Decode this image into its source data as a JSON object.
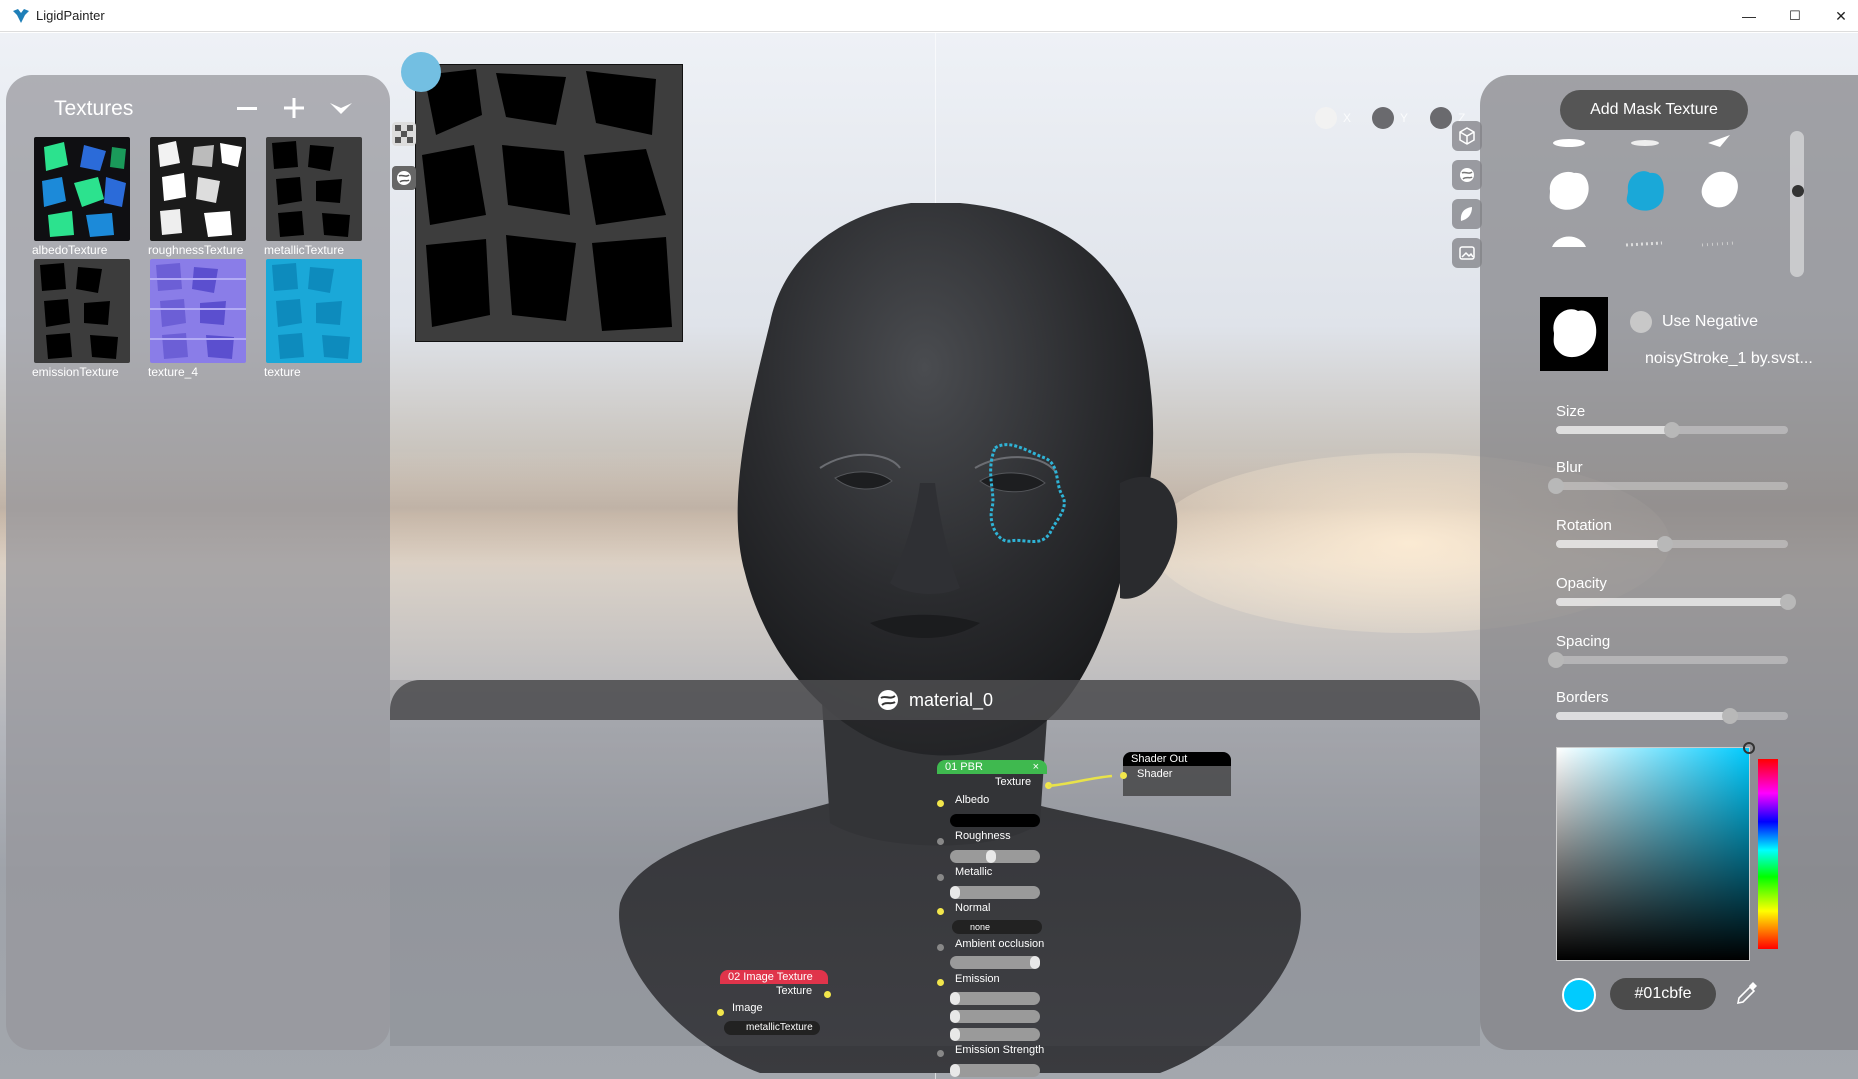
{
  "window": {
    "title": "LigidPainter",
    "controls": {
      "minimize": "—",
      "maximize": "☐",
      "close": "✕"
    }
  },
  "textures_panel": {
    "title": "Textures",
    "items": [
      {
        "label": "albedoTexture",
        "style": "albedo"
      },
      {
        "label": "roughnessTexture",
        "style": "rough"
      },
      {
        "label": "metallicTexture",
        "style": "metal"
      },
      {
        "label": "emissionTexture",
        "style": "emission"
      },
      {
        "label": "texture_4",
        "style": "violet"
      },
      {
        "label": "texture",
        "style": "cyan"
      }
    ]
  },
  "axis": [
    {
      "label": "X",
      "color": "#f2f2f2"
    },
    {
      "label": "Y",
      "color": "#6a6a6e"
    },
    {
      "label": "Z",
      "color": "#6a6a6e"
    }
  ],
  "mask_panel": {
    "add_button": "Add Mask Texture",
    "use_negative": "Use Negative",
    "mask_name": "noisyStroke_1 by.svst...",
    "sliders": [
      {
        "label": "Size",
        "value": 0.5
      },
      {
        "label": "Blur",
        "value": 0.0
      },
      {
        "label": "Rotation",
        "value": 0.47
      },
      {
        "label": "Opacity",
        "value": 1.0
      },
      {
        "label": "Spacing",
        "value": 0.0
      },
      {
        "label": "Borders",
        "value": 0.75
      }
    ],
    "color_hex": "#01cbfe"
  },
  "node_editor": {
    "title": "material_0",
    "pbr_node": {
      "header": "01 PBR",
      "output": "Texture",
      "inputs": {
        "albedo": "Albedo",
        "roughness": "Roughness",
        "metallic": "Metallic",
        "normal": "Normal",
        "normal_value": "none",
        "ambient": "Ambient occlusion",
        "emission": "Emission",
        "emission_strength": "Emission Strength"
      }
    },
    "shader_out": {
      "header": "Shader Out",
      "input": "Shader"
    },
    "image_node": {
      "header": "02 Image Texture",
      "output": "Texture",
      "input": "Image",
      "value": "metallicTexture"
    }
  },
  "colors": {
    "accent": "#01cbfe",
    "pbr_header": "#3fb94f",
    "image_header": "#e0344b",
    "pin": "#f2e64b"
  }
}
